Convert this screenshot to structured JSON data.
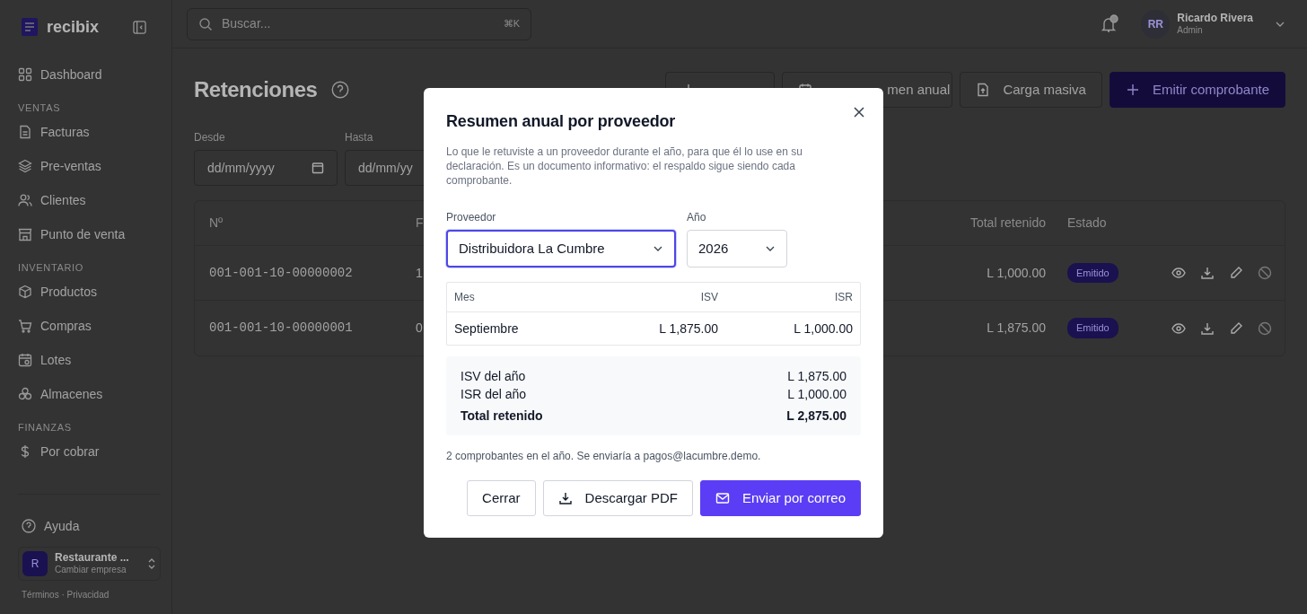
{
  "sidebar": {
    "brand": "recibix",
    "items": [
      {
        "kind": "item",
        "label": "Dashboard"
      },
      {
        "kind": "section",
        "label": "VENTAS"
      },
      {
        "kind": "item",
        "label": "Facturas"
      },
      {
        "kind": "item",
        "label": "Pre-ventas"
      },
      {
        "kind": "item",
        "label": "Clientes"
      },
      {
        "kind": "item",
        "label": "Punto de venta"
      },
      {
        "kind": "section",
        "label": "INVENTARIO"
      },
      {
        "kind": "item",
        "label": "Productos"
      },
      {
        "kind": "item",
        "label": "Compras"
      },
      {
        "kind": "item",
        "label": "Lotes"
      },
      {
        "kind": "item",
        "label": "Almacenes"
      },
      {
        "kind": "section",
        "label": "FINANZAS"
      },
      {
        "kind": "item",
        "label": "Por cobrar"
      }
    ],
    "help": "Ayuda",
    "company": {
      "initial": "R",
      "name": "Restaurante ...",
      "action": "Cambiar empresa"
    },
    "footer": "Términos · Privacidad"
  },
  "topbar": {
    "search": {
      "placeholder": "Buscar...",
      "shortcut": "⌘K"
    },
    "user": {
      "initials": "RR",
      "name": "Ricardo Rivera",
      "role": "Admin"
    }
  },
  "page": {
    "title": "Retenciones",
    "actions": [
      {
        "kind": "outline"
      },
      {
        "label": "men anual",
        "kind": "outline"
      },
      {
        "label": "Carga masiva",
        "kind": "outline"
      },
      {
        "label": "Emitir comprobante",
        "kind": "primary"
      }
    ],
    "filters": [
      {
        "label": "Desde",
        "placeholder": "dd/mm/yyyy"
      },
      {
        "label": "Hasta",
        "placeholder": "dd/mm/yy"
      }
    ],
    "table": {
      "columns": [
        "Nº",
        "F",
        "Total retenido",
        "Estado"
      ],
      "rows": [
        {
          "number": "001-001-10-00000002",
          "column_2": "1",
          "total": "L 1,000.00",
          "status": "Emitido"
        },
        {
          "number": "001-001-10-00000001",
          "column_2": "0",
          "total": "L 1,875.00",
          "status": "Emitido"
        }
      ]
    }
  },
  "modal": {
    "title": "Resumen anual por proveedor",
    "description": "Lo que le retuviste a un proveedor durante el año, para que él lo use en su declaración. Es un documento informativo: el respaldo sigue siendo cada comprobante.",
    "supplier": {
      "label": "Proveedor",
      "value": "Distribuidora La Cumbre",
      "focused": true
    },
    "year": {
      "label": "Año",
      "value": "2026",
      "focused": false
    },
    "table": {
      "columns": [
        "Mes",
        "ISV",
        "ISR"
      ],
      "rows": [
        {
          "month": "Septiembre",
          "isv": "L 1,875.00",
          "isr": "L 1,000.00"
        }
      ]
    },
    "summary": [
      {
        "label": "ISV del año",
        "value": "L 1,875.00",
        "kind": "line"
      },
      {
        "label": "ISR del año",
        "value": "L 1,000.00",
        "kind": "line"
      },
      {
        "label": "Total retenido",
        "value": "L 2,875.00",
        "kind": "total"
      }
    ],
    "note": "2 comprobantes en el año. Se enviaría a pagos@lacumbre.demo.",
    "buttons": [
      {
        "label": "Cerrar",
        "kind": "plain"
      },
      {
        "label": "Descargar PDF",
        "kind": "download"
      },
      {
        "label": "Enviar por correo",
        "kind": "email"
      }
    ]
  }
}
